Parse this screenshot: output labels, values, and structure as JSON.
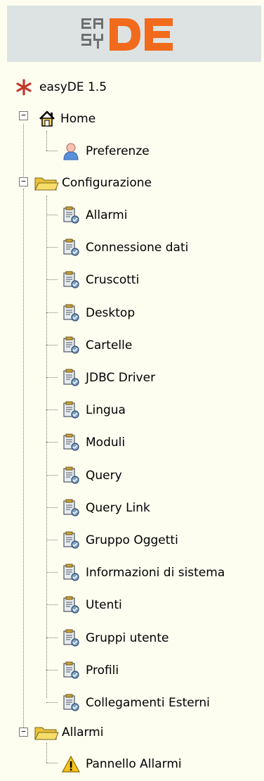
{
  "logo": {
    "name": "easyDE"
  },
  "tree": {
    "root": {
      "label": "easyDE 1.5"
    },
    "home": {
      "label": "Home",
      "children": [
        {
          "label": "Preferenze"
        }
      ]
    },
    "configurazione": {
      "label": "Configurazione",
      "children": [
        {
          "label": "Allarmi"
        },
        {
          "label": "Connessione dati"
        },
        {
          "label": "Cruscotti"
        },
        {
          "label": "Desktop"
        },
        {
          "label": "Cartelle"
        },
        {
          "label": "JDBC Driver"
        },
        {
          "label": "Lingua"
        },
        {
          "label": "Moduli"
        },
        {
          "label": "Query"
        },
        {
          "label": "Query Link"
        },
        {
          "label": "Gruppo Oggetti"
        },
        {
          "label": "Informazioni di sistema"
        },
        {
          "label": "Utenti"
        },
        {
          "label": "Gruppi utente"
        },
        {
          "label": "Profili"
        },
        {
          "label": "Collegamenti Esterni"
        }
      ]
    },
    "allarmi": {
      "label": "Allarmi",
      "children": [
        {
          "label": "Pannello Allarmi"
        }
      ]
    }
  },
  "colors": {
    "logo_orange": "#f26b1d",
    "logo_grey": "#6f6f6f",
    "star": "#c0392b"
  }
}
